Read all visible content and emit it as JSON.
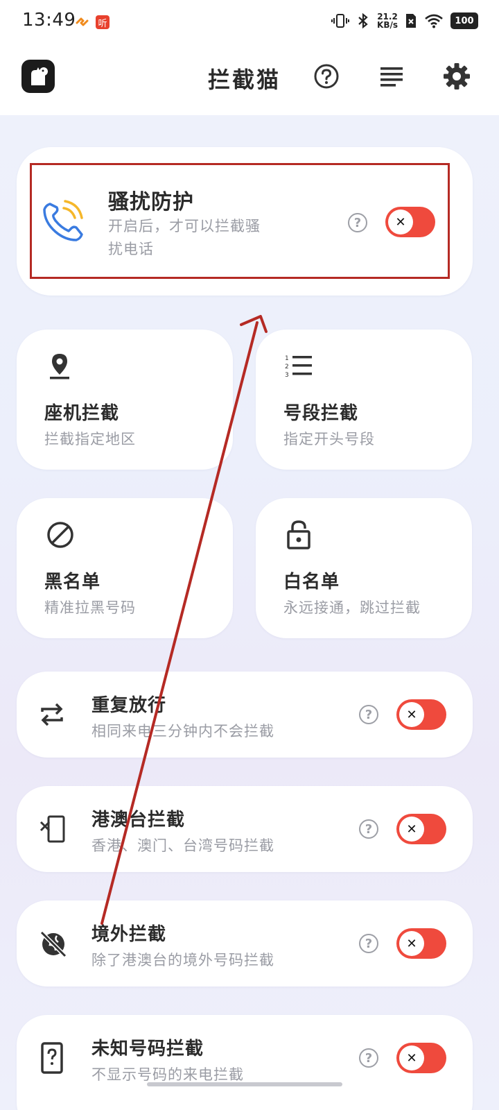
{
  "status_bar": {
    "time": "13:49",
    "net_speed_value": "21.2",
    "net_speed_unit": "KB/s",
    "battery": "100",
    "notif_badge": "听"
  },
  "header": {
    "title": "拦截猫"
  },
  "protection": {
    "title": "骚扰防护",
    "subtitle_line1": "开启后，才可以拦截骚",
    "subtitle_line2": "扰电话",
    "enabled": false
  },
  "tiles": [
    {
      "title": "座机拦截",
      "subtitle": "拦截指定地区",
      "icon": "location-pin-icon"
    },
    {
      "title": "号段拦截",
      "subtitle": "指定开头号段",
      "icon": "numbered-list-icon"
    },
    {
      "title": "黑名单",
      "subtitle": "精准拉黑号码",
      "icon": "block-icon"
    },
    {
      "title": "白名单",
      "subtitle": "永远接通，跳过拦截",
      "icon": "unlock-icon"
    }
  ],
  "rows": [
    {
      "title": "重复放行",
      "subtitle": "相同来电三分钟内不会拦截",
      "icon": "repeat-icon",
      "enabled": false
    },
    {
      "title": "港澳台拦截",
      "subtitle": "香港、澳门、台湾号码拦截",
      "icon": "phone-x-icon",
      "enabled": false
    },
    {
      "title": "境外拦截",
      "subtitle": "除了港澳台的境外号码拦截",
      "icon": "globe-off-icon",
      "enabled": false
    },
    {
      "title": "未知号码拦截",
      "subtitle": "不显示号码的来电拦截",
      "icon": "phone-question-icon",
      "enabled": false
    }
  ],
  "colors": {
    "toggle_off_red": "#ef4a3d",
    "annotation_red": "#b52a24",
    "accent_blue": "#3a7be0",
    "accent_yellow": "#f5b72a"
  }
}
